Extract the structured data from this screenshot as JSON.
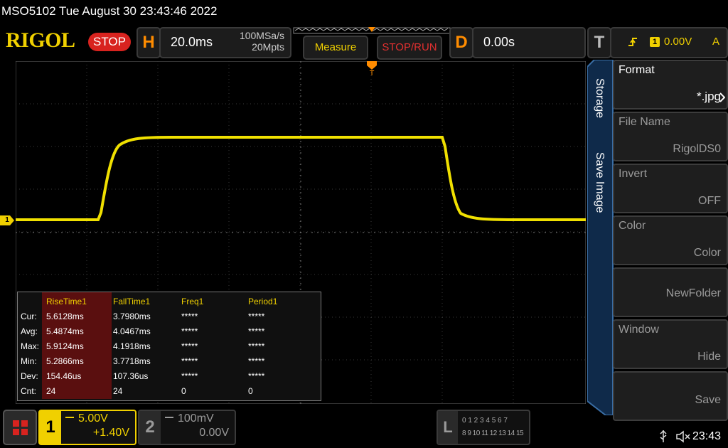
{
  "header": {
    "title": "MSO5102  Tue August 30 23:43:46 2022",
    "logo": "RIGOL",
    "run_state": "STOP",
    "horizontal": {
      "letter": "H",
      "timebase": "20.0ms",
      "sample_rate": "100MSa/s",
      "memory_depth": "20Mpts"
    },
    "measure_label": "Measure",
    "stop_run_label": "STOP/RUN",
    "delay": {
      "letter": "D",
      "value": "0.00s"
    },
    "trigger": {
      "letter": "T",
      "source": "1",
      "level": "0.00V",
      "mode": "A"
    }
  },
  "side_menu": {
    "tabs": [
      "Storage",
      "Save Image"
    ],
    "items": [
      {
        "title": "Format",
        "value": "*.jpg"
      },
      {
        "title": "File Name",
        "value": "RigolDS0"
      },
      {
        "title": "Invert",
        "value": "OFF"
      },
      {
        "title": "Color",
        "value": "Color"
      },
      {
        "title": "",
        "value": "NewFolder"
      },
      {
        "title": "Window",
        "value": "Hide"
      },
      {
        "title": "",
        "value": "Save"
      }
    ]
  },
  "measurements": {
    "headers": [
      "",
      "RiseTime1",
      "FallTime1",
      "Freq1",
      "Period1"
    ],
    "rows": [
      [
        "Cur:",
        "5.6128ms",
        "3.7980ms",
        "*****",
        "*****"
      ],
      [
        "Avg:",
        "5.4874ms",
        "4.0467ms",
        "*****",
        "*****"
      ],
      [
        "Max:",
        "5.9124ms",
        "4.1918ms",
        "*****",
        "*****"
      ],
      [
        "Min:",
        "5.2866ms",
        "3.7718ms",
        "*****",
        "*****"
      ],
      [
        "Dev:",
        "154.46us",
        "107.36us",
        "*****",
        "*****"
      ],
      [
        "Cnt:",
        "24",
        "24",
        "0",
        "0"
      ]
    ]
  },
  "channels": {
    "ch1": {
      "number": "1",
      "scale": "5.00V",
      "offset": "+1.40V",
      "color": "#f0d000"
    },
    "ch2": {
      "number": "2",
      "scale": "100mV",
      "offset": "0.00V",
      "color": "#9a9a9a"
    }
  },
  "logic": {
    "letter": "L",
    "row1": "0 1 2 3  4 5 6 7",
    "row2": "8 9 10 11 12 13 14 15"
  },
  "status": {
    "time": "23:43"
  },
  "colors": {
    "accent": "#f0d000",
    "stop": "#d8231f",
    "panel": "#1e1e1e"
  },
  "icons": {
    "usb": "usb-icon",
    "speaker": "speaker-muted-icon",
    "trigger_edge": "rising-edge-icon",
    "menu": "main-menu-icon"
  }
}
